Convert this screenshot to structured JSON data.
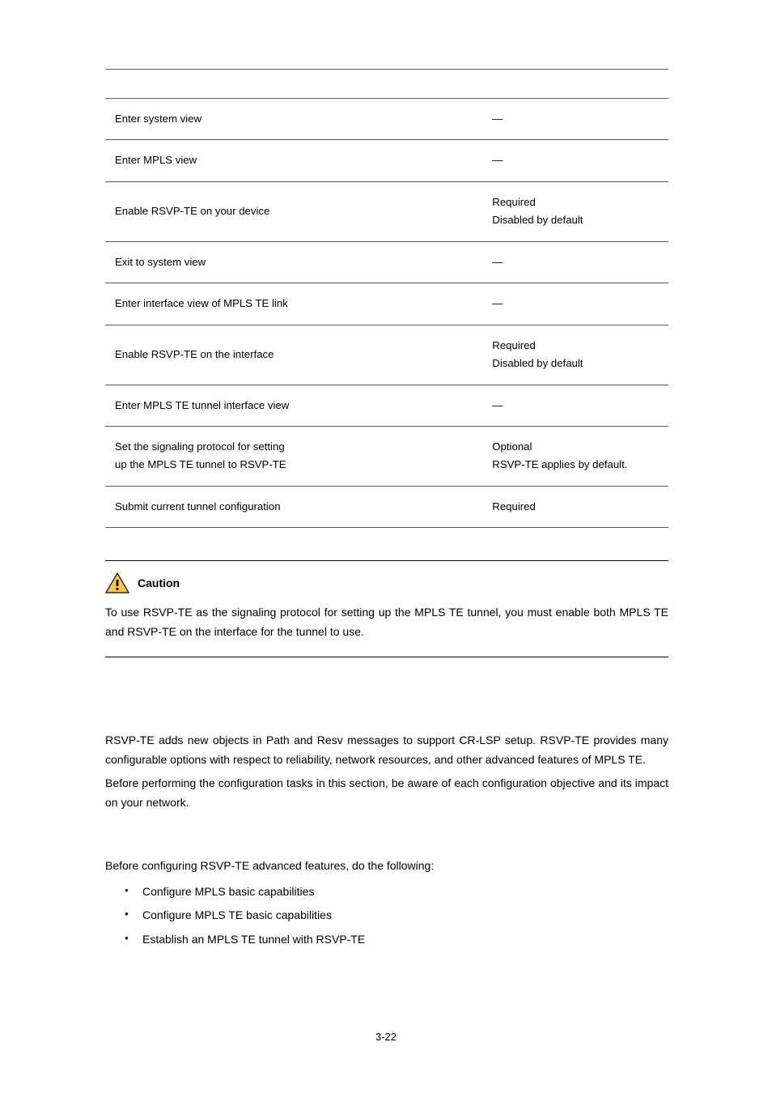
{
  "table": {
    "headers": [
      "",
      "",
      ""
    ],
    "rows": [
      {
        "c1": "Enter system view",
        "c2": "",
        "c3": "—"
      },
      {
        "c1": "Enter MPLS view",
        "c2": "",
        "c3": "—"
      },
      {
        "c1": "Enable RSVP-TE on your device",
        "c2": "",
        "c3": "Required\nDisabled by default"
      },
      {
        "c1": "Exit to system view",
        "c2": "",
        "c3": "—"
      },
      {
        "c1": "Enter interface view of MPLS TE link",
        "c2": "",
        "c3": "—"
      },
      {
        "c1": "Enable RSVP-TE on the interface",
        "c2": "",
        "c3": "Required\nDisabled by default"
      },
      {
        "c1": "Enter MPLS TE tunnel interface view",
        "c2": "",
        "c3": "—"
      },
      {
        "c1": "Set the signaling protocol for setting up the MPLS TE tunnel to RSVP-TE",
        "c2": "",
        "c3": "Optional\nRSVP-TE applies by default."
      },
      {
        "c1": "Submit current tunnel configuration",
        "c2": "",
        "c3": "Required"
      }
    ]
  },
  "caution": {
    "label": "Caution",
    "text": "To use RSVP-TE as the signaling protocol for setting up the MPLS TE tunnel, you must enable both MPLS TE and RSVP-TE on the interface for the tunnel to use."
  },
  "section": {
    "p1": "RSVP-TE adds new objects in Path and Resv messages to support CR-LSP setup. RSVP-TE provides many configurable options with respect to reliability, network resources, and other advanced features of MPLS TE.",
    "p2": "Before performing the configuration tasks in this section, be aware of each configuration objective and its impact on your network."
  },
  "prereq": {
    "intro": "Before configuring RSVP-TE advanced features, do the following:",
    "items": [
      "Configure MPLS basic capabilities",
      "Configure MPLS TE basic capabilities",
      "Establish an MPLS TE tunnel with RSVP-TE"
    ]
  },
  "page_number": "3-22"
}
